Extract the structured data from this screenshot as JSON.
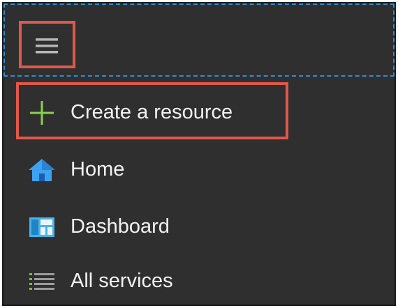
{
  "menu": {
    "toggle_icon": "hamburger-icon",
    "highlight_color": "#e0584a",
    "items": [
      {
        "label": "Create a resource",
        "icon": "plus-icon",
        "color": "#8ad14b"
      },
      {
        "label": "Home",
        "icon": "home-icon",
        "color": "#3da2f2"
      },
      {
        "label": "Dashboard",
        "icon": "dashboard-icon",
        "color": "#49b3e8"
      },
      {
        "label": "All services",
        "icon": "list-icon",
        "color": "#7fbb43"
      }
    ]
  }
}
